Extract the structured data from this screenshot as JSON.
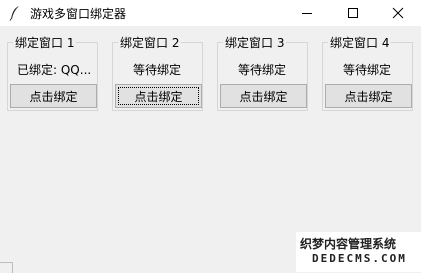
{
  "window": {
    "title": "游戏多窗口绑定器",
    "icon": "feather-icon",
    "controls": [
      "minimize-icon",
      "maximize-icon",
      "close-icon"
    ]
  },
  "slots": [
    {
      "label": "绑定窗口 1",
      "status": "已绑定: QQ...",
      "button": "点击绑定"
    },
    {
      "label": "绑定窗口 2",
      "status": "等待绑定",
      "button": "点击绑定"
    },
    {
      "label": "绑定窗口 3",
      "status": "等待绑定",
      "button": "点击绑定"
    },
    {
      "label": "绑定窗口 4",
      "status": "等待绑定",
      "button": "点击绑定"
    }
  ],
  "watermark": {
    "line1": "织梦内容管理系统",
    "line2": "DEDECMS.COM"
  },
  "colors": {
    "background": "#f0f0f0",
    "titlebar": "#ffffff",
    "button_face": "#e1e1e1",
    "button_border": "#adadad",
    "group_border": "#d6d6d6"
  }
}
